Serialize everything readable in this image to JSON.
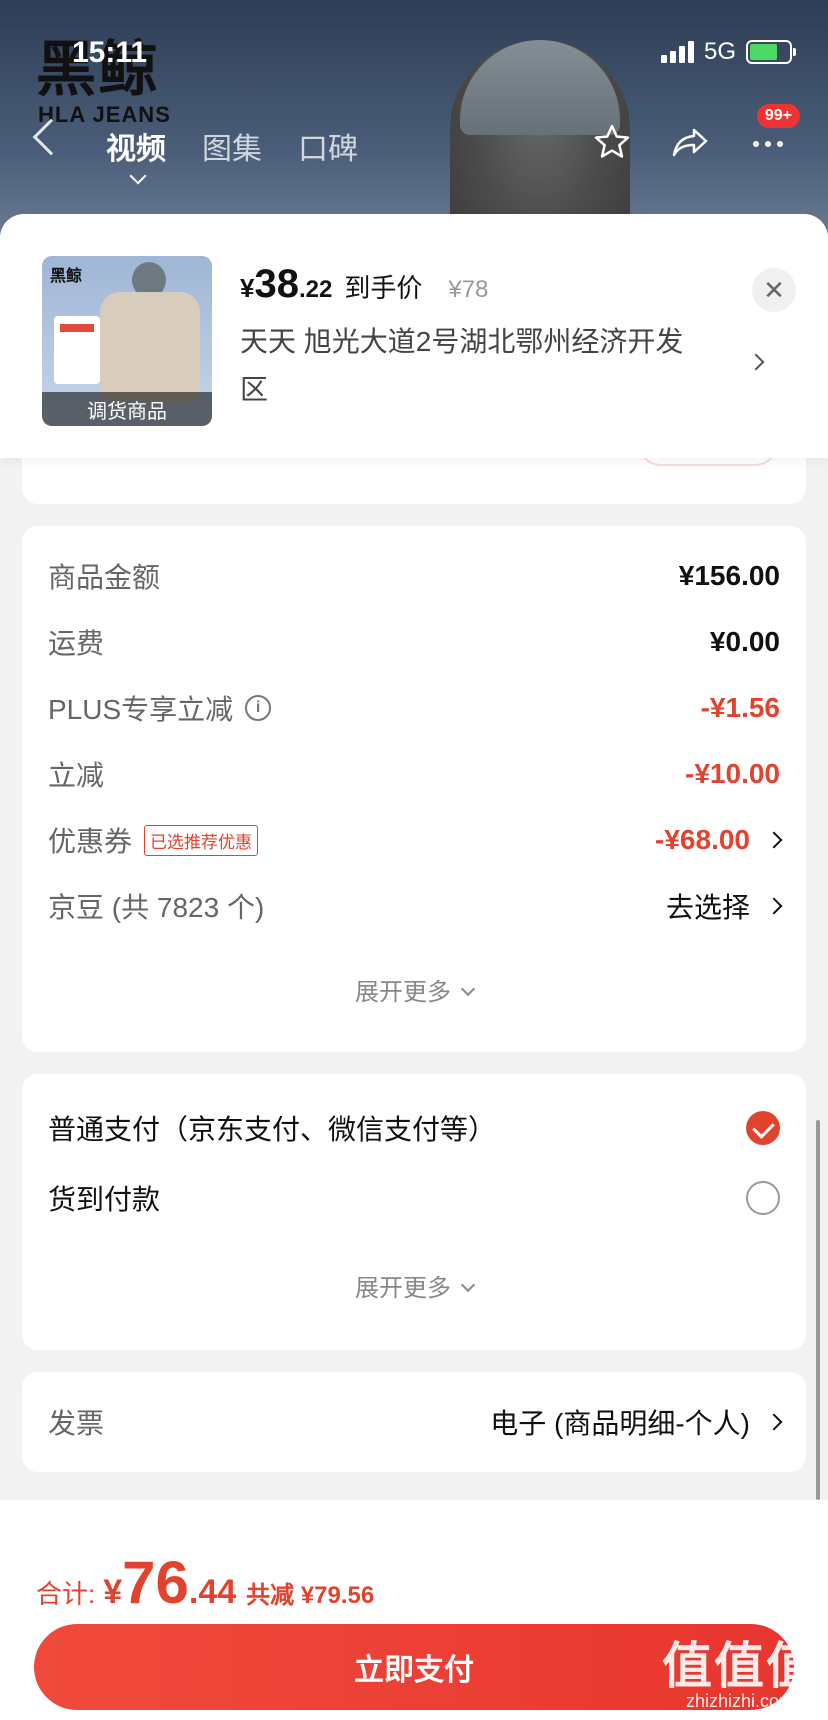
{
  "status_bar": {
    "time": "15:11",
    "network": "5G"
  },
  "brand": {
    "logo_text": "黑鲸",
    "sub_text": "HLA JEANS"
  },
  "nav": {
    "tabs": [
      "视频",
      "图集",
      "口碑"
    ],
    "active_tab": "视频",
    "badge": "99+"
  },
  "product": {
    "yen": "¥",
    "price_int": "38",
    "price_dec": ".22",
    "price_label": "到手价",
    "original_price": "¥78",
    "address": "天天  旭光大道2号湖北鄂州经济开发区",
    "thumb_logo": "黑鲸",
    "thumb_caption": "调货商品"
  },
  "summary": {
    "rows": [
      {
        "label": "商品金额",
        "value": "¥156.00"
      },
      {
        "label": "运费",
        "value": "¥0.00"
      },
      {
        "label": "PLUS专享立减",
        "value": "-¥1.56"
      },
      {
        "label": "立减",
        "value": "-¥10.00"
      },
      {
        "label": "优惠券",
        "tag": "已选推荐优惠",
        "value": "-¥68.00"
      },
      {
        "label": "京豆 (共 7823 个)",
        "value": "去选择"
      }
    ],
    "expand_label": "展开更多"
  },
  "payment": {
    "options": [
      {
        "label": "普通支付（京东支付、微信支付等）",
        "selected": true
      },
      {
        "label": "货到付款",
        "selected": false
      }
    ],
    "expand_label": "展开更多"
  },
  "invoice": {
    "label": "发票",
    "value": "电子 (商品明细-个人)"
  },
  "footer": {
    "total_label": "合计:",
    "total_yen": "¥",
    "total_int": "76",
    "total_dec": ".44",
    "saving": "共减 ¥79.56",
    "pay_button": "立即支付"
  },
  "watermark": {
    "main": "值值值",
    "sub": "zhizhizhi.com"
  },
  "colors": {
    "accent": "#e2432f",
    "banner": "#3b4a63"
  }
}
